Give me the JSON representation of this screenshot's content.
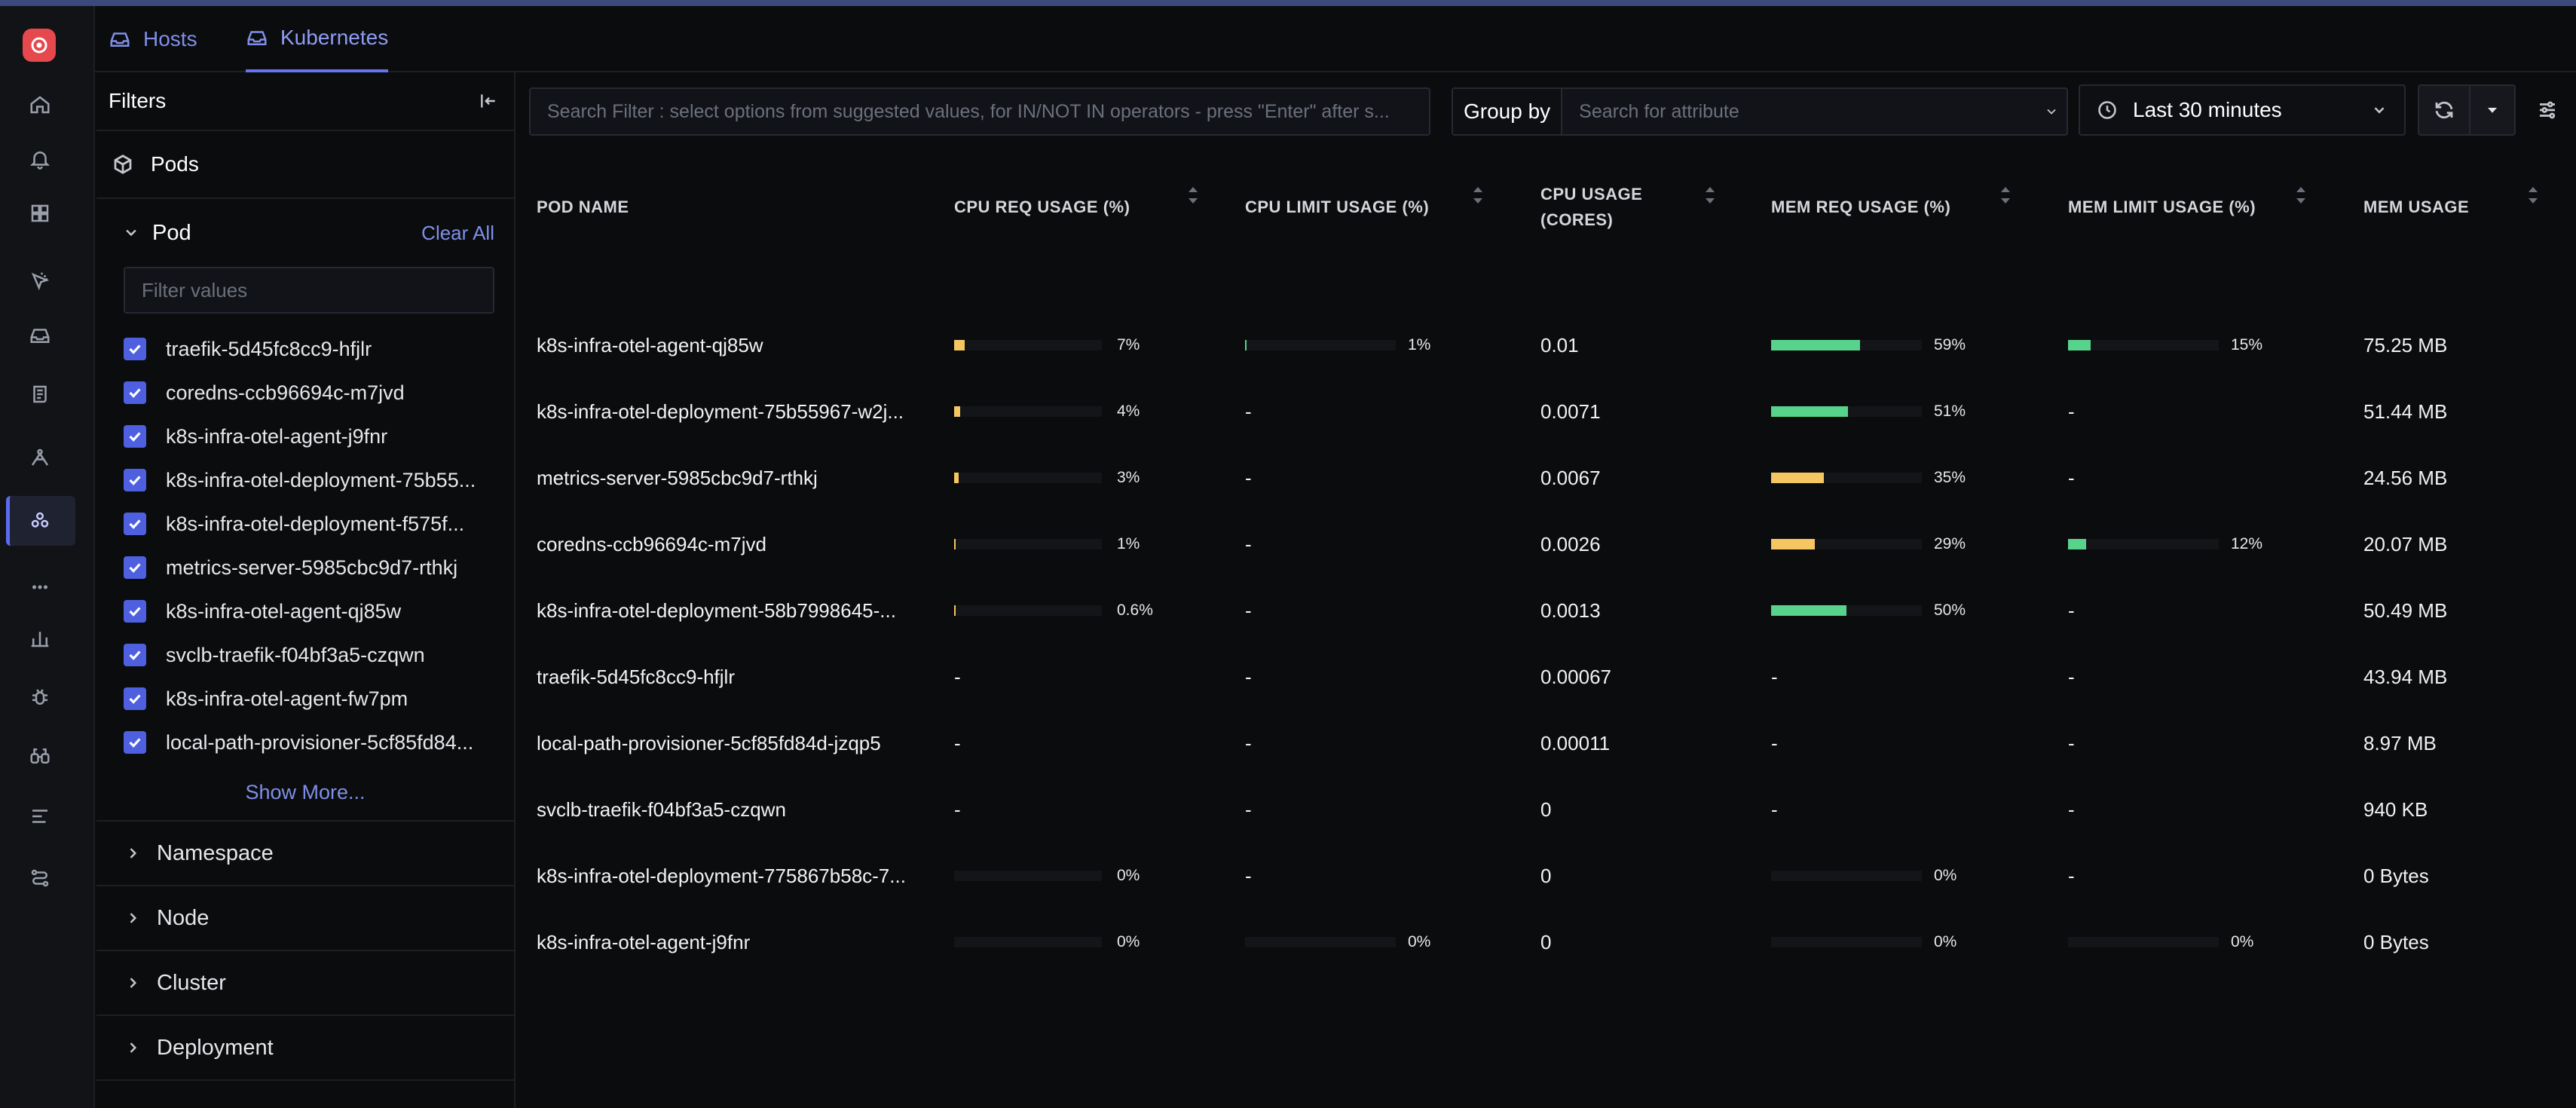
{
  "tabs": [
    {
      "label": "Hosts",
      "active": false
    },
    {
      "label": "Kubernetes",
      "active": true
    }
  ],
  "filters": {
    "title": "Filters",
    "entity": "Pods",
    "pod_section": {
      "title": "Pod",
      "clear_label": "Clear All",
      "input_placeholder": "Filter values",
      "items": [
        "traefik-5d45fc8cc9-hfjlr",
        "coredns-ccb96694c-m7jvd",
        "k8s-infra-otel-agent-j9fnr",
        "k8s-infra-otel-deployment-75b55...",
        "k8s-infra-otel-deployment-f575f...",
        "metrics-server-5985cbc9d7-rthkj",
        "k8s-infra-otel-agent-qj85w",
        "svclb-traefik-f04bf3a5-czqwn",
        "k8s-infra-otel-agent-fw7pm",
        "local-path-provisioner-5cf85fd84..."
      ],
      "show_more": "Show More..."
    },
    "collapsed_sections": [
      "Namespace",
      "Node",
      "Cluster",
      "Deployment"
    ]
  },
  "toolbar": {
    "search_placeholder": "Search Filter : select options from suggested values, for IN/NOT IN operators - press \"Enter\" after s...",
    "group_by_label": "Group by",
    "group_by_placeholder": "Search for attribute",
    "time_range": "Last 30 minutes"
  },
  "table": {
    "columns": {
      "pod_name": "POD NAME",
      "cpu_req": "CPU REQ USAGE (%)",
      "cpu_limit": "CPU LIMIT USAGE (%)",
      "cpu_usage_1": "CPU USAGE",
      "cpu_usage_2": "(CORES)",
      "mem_req": "MEM REQ USAGE (%)",
      "mem_limit": "MEM LIMIT USAGE (%)",
      "mem_usage": "MEM USAGE"
    },
    "rows": [
      {
        "name": "k8s-infra-otel-agent-qj85w",
        "cpu_req": "7%",
        "cpu_req_frac": 0.07,
        "cpu_limit": "1%",
        "cpu_limit_frac": 0.01,
        "cpu": "0.01",
        "mem_req": "59%",
        "mem_req_frac": 0.59,
        "mem_limit": "15%",
        "mem_limit_frac": 0.15,
        "mem": "75.25 MB"
      },
      {
        "name": "k8s-infra-otel-deployment-75b55967-w2j...",
        "cpu_req": "4%",
        "cpu_req_frac": 0.04,
        "cpu_limit": "-",
        "cpu": "0.0071",
        "mem_req": "51%",
        "mem_req_frac": 0.51,
        "mem_limit": "-",
        "mem": "51.44 MB"
      },
      {
        "name": "metrics-server-5985cbc9d7-rthkj",
        "cpu_req": "3%",
        "cpu_req_frac": 0.03,
        "cpu_limit": "-",
        "cpu": "0.0067",
        "mem_req": "35%",
        "mem_req_frac": 0.35,
        "mem_limit": "-",
        "mem": "24.56 MB"
      },
      {
        "name": "coredns-ccb96694c-m7jvd",
        "cpu_req": "1%",
        "cpu_req_frac": 0.01,
        "cpu_limit": "-",
        "cpu": "0.0026",
        "mem_req": "29%",
        "mem_req_frac": 0.29,
        "mem_limit": "12%",
        "mem_limit_frac": 0.12,
        "mem": "20.07 MB"
      },
      {
        "name": "k8s-infra-otel-deployment-58b7998645-...",
        "cpu_req": "0.6%",
        "cpu_req_frac": 0.006,
        "cpu_limit": "-",
        "cpu": "0.0013",
        "mem_req": "50%",
        "mem_req_frac": 0.5,
        "mem_limit": "-",
        "mem": "50.49 MB"
      },
      {
        "name": "traefik-5d45fc8cc9-hfjlr",
        "cpu_req": "-",
        "cpu_limit": "-",
        "cpu": "0.00067",
        "mem_req": "-",
        "mem_limit": "-",
        "mem": "43.94 MB"
      },
      {
        "name": "local-path-provisioner-5cf85fd84d-jzqp5",
        "cpu_req": "-",
        "cpu_limit": "-",
        "cpu": "0.00011",
        "mem_req": "-",
        "mem_limit": "-",
        "mem": "8.97 MB"
      },
      {
        "name": "svclb-traefik-f04bf3a5-czqwn",
        "cpu_req": "-",
        "cpu_limit": "-",
        "cpu": "0",
        "mem_req": "-",
        "mem_limit": "-",
        "mem": "940 KB"
      },
      {
        "name": "k8s-infra-otel-deployment-775867b58c-7...",
        "cpu_req": "0%",
        "cpu_req_frac": 0,
        "cpu_limit": "-",
        "cpu": "0",
        "mem_req": "0%",
        "mem_req_frac": 0,
        "mem_limit": "-",
        "mem": "0 Bytes"
      },
      {
        "name": "k8s-infra-otel-agent-j9fnr",
        "cpu_req": "0%",
        "cpu_req_frac": 0,
        "cpu_limit": "0%",
        "cpu_limit_frac": 0,
        "cpu": "0",
        "mem_req": "0%",
        "mem_req_frac": 0,
        "mem_limit": "0%",
        "mem_limit_frac": 0,
        "mem": "0 Bytes"
      }
    ]
  },
  "colors": {
    "accent": "#6474f3",
    "bar_yellow": "#f5c662",
    "bar_green": "#58d38c",
    "logo_red": "#e5484d"
  },
  "icons": {
    "rail": [
      "home-icon",
      "alerts-icon",
      "dashboards-icon",
      "exceptions-icon",
      "infra-icon",
      "logs-icon",
      "traces-icon",
      "kubernetes-icon",
      "more-icon",
      "metrics-icon",
      "bug-icon",
      "explore-icon",
      "pipelines-icon",
      "integrations-icon"
    ]
  }
}
